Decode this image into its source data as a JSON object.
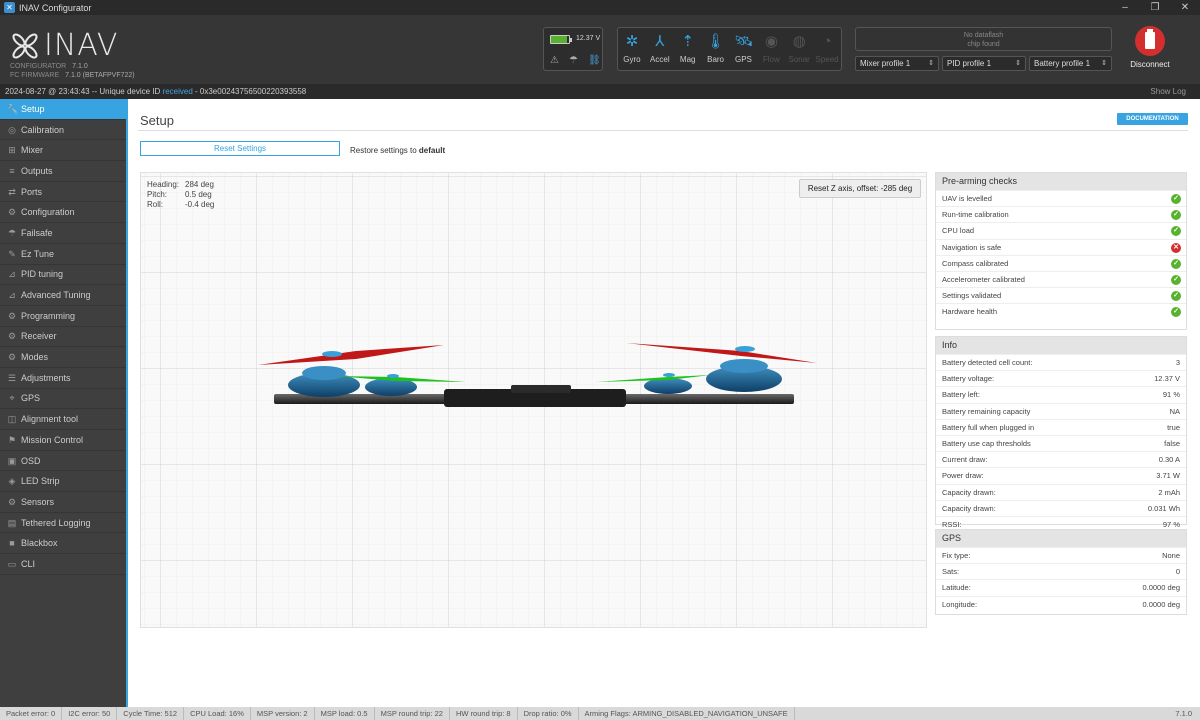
{
  "window": {
    "title": "INAV Configurator"
  },
  "header": {
    "logo_text": "INAV",
    "configurator_label": "CONFIGURATOR",
    "configurator_version": "7.1.0",
    "firmware_label": "FC FIRMWARE",
    "firmware_version": "7.1.0 (BETAFPVF722)",
    "battery_voltage": "12.37 V",
    "battery_level": 0.91,
    "sensors": [
      {
        "label": "Gyro",
        "icon": "gyro-icon",
        "active": true
      },
      {
        "label": "Accel",
        "icon": "accel-icon",
        "active": true
      },
      {
        "label": "Mag",
        "icon": "mag-icon",
        "active": true
      },
      {
        "label": "Baro",
        "icon": "baro-icon",
        "active": true
      },
      {
        "label": "GPS",
        "icon": "gps-icon",
        "active": true
      },
      {
        "label": "Flow",
        "icon": "flow-icon",
        "active": false
      },
      {
        "label": "Sonar",
        "icon": "sonar-icon",
        "active": false
      },
      {
        "label": "Speed",
        "icon": "speed-icon",
        "active": false
      }
    ],
    "dataflash_line1": "No dataflash",
    "dataflash_line2": "chip found",
    "mixer_profile": "Mixer profile 1",
    "pid_profile": "PID profile 1",
    "battery_profile": "Battery profile 1",
    "disconnect_label": "Disconnect"
  },
  "status_line": {
    "prefix": "2024-08-27 @ 23:43:43 -- Unique device ID ",
    "received": "received",
    "suffix": " - 0x3e0024375650022039355­8",
    "show_log": "Show Log"
  },
  "sidebar": {
    "items": [
      {
        "label": "Setup",
        "icon": "wrench-icon",
        "active": true
      },
      {
        "label": "Calibration",
        "icon": "calibration-icon"
      },
      {
        "label": "Mixer",
        "icon": "mixer-icon"
      },
      {
        "label": "Outputs",
        "icon": "outputs-icon"
      },
      {
        "label": "Ports",
        "icon": "ports-icon"
      },
      {
        "label": "Configuration",
        "icon": "gear-icon"
      },
      {
        "label": "Failsafe",
        "icon": "failsafe-icon"
      },
      {
        "label": "Ez Tune",
        "icon": "eztune-icon"
      },
      {
        "label": "PID tuning",
        "icon": "pid-icon"
      },
      {
        "label": "Advanced Tuning",
        "icon": "advanced-tuning-icon"
      },
      {
        "label": "Programming",
        "icon": "programming-icon"
      },
      {
        "label": "Receiver",
        "icon": "receiver-icon"
      },
      {
        "label": "Modes",
        "icon": "modes-icon"
      },
      {
        "label": "Adjustments",
        "icon": "adjustments-icon"
      },
      {
        "label": "GPS",
        "icon": "gps-icon"
      },
      {
        "label": "Alignment tool",
        "icon": "alignment-icon"
      },
      {
        "label": "Mission Control",
        "icon": "mission-icon"
      },
      {
        "label": "OSD",
        "icon": "osd-icon"
      },
      {
        "label": "LED Strip",
        "icon": "led-icon"
      },
      {
        "label": "Sensors",
        "icon": "sensors-icon"
      },
      {
        "label": "Tethered Logging",
        "icon": "tethered-log-icon"
      },
      {
        "label": "Blackbox",
        "icon": "blackbox-icon"
      },
      {
        "label": "CLI",
        "icon": "cli-icon"
      }
    ]
  },
  "main": {
    "title": "Setup",
    "documentation": "DOCUMENTATION",
    "reset_settings": "Reset Settings",
    "restore_prefix": "Restore settings to ",
    "restore_bold": "default",
    "attitude": [
      {
        "key": "Heading:",
        "value": "284 deg"
      },
      {
        "key": "Pitch:",
        "value": "0.5 deg"
      },
      {
        "key": "Roll:",
        "value": "-0.4 deg"
      }
    ],
    "reset_z": "Reset Z axis, offset: -285 deg"
  },
  "prearm": {
    "title": "Pre-arming checks",
    "checks": [
      {
        "label": "UAV is levelled",
        "ok": true
      },
      {
        "label": "Run-time calibration",
        "ok": true
      },
      {
        "label": "CPU load",
        "ok": true
      },
      {
        "label": "Navigation is safe",
        "ok": false
      },
      {
        "label": "Compass calibrated",
        "ok": true
      },
      {
        "label": "Accelerometer calibrated",
        "ok": true
      },
      {
        "label": "Settings validated",
        "ok": true
      },
      {
        "label": "Hardware health",
        "ok": true
      }
    ]
  },
  "info": {
    "title": "Info",
    "rows": [
      {
        "label": "Battery detected cell count:",
        "value": "3"
      },
      {
        "label": "Battery voltage:",
        "value": "12.37 V"
      },
      {
        "label": "Battery left:",
        "value": "91 %"
      },
      {
        "label": "Battery remaining capacity",
        "value": "NA"
      },
      {
        "label": "Battery full when plugged in",
        "value": "true"
      },
      {
        "label": "Battery use cap thresholds",
        "value": "false"
      },
      {
        "label": "Current draw:",
        "value": "0.30 A"
      },
      {
        "label": "Power draw:",
        "value": "3.71 W"
      },
      {
        "label": "Capacity drawn:",
        "value": "2 mAh"
      },
      {
        "label": "Capacity drawn:",
        "value": "0.031 Wh"
      },
      {
        "label": "RSSI:",
        "value": "97 %"
      }
    ]
  },
  "gps": {
    "title": "GPS",
    "rows": [
      {
        "label": "Fix type:",
        "value": "None"
      },
      {
        "label": "Sats:",
        "value": "0"
      },
      {
        "label": "Latitude:",
        "value": "0.0000 deg"
      },
      {
        "label": "Longitude:",
        "value": "0.0000 deg"
      }
    ]
  },
  "footer": {
    "items": [
      "Packet error: 0",
      "I2C error: 50",
      "Cycle Time: 512",
      "CPU Load: 16%",
      "MSP version: 2",
      "MSP load: 0.5",
      "MSP round trip: 22",
      "HW round trip: 8",
      "Drop ratio: 0%",
      "Arming Flags: ARMING_DISABLED_NAVIGATION_UNSAFE"
    ],
    "version": "7.1.0"
  },
  "colors": {
    "accent": "#37a3e0",
    "ok": "#59b22f",
    "error": "#d32f2f"
  }
}
